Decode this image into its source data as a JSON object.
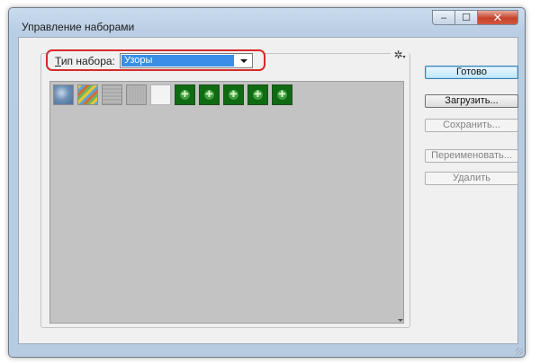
{
  "window": {
    "title": "Управление наборами",
    "controls": {
      "minimize": "‒",
      "maximize": "☐",
      "close": "✕"
    }
  },
  "preset_type": {
    "label_prefix": "Т",
    "label_rest": "ип набора:",
    "selected": "Узоры"
  },
  "settings_menu": {
    "icon": "gear-icon",
    "glyph": "✲",
    "arrow": "▾"
  },
  "swatches": [
    {
      "kind": "blue-texture",
      "style": "sw-blue"
    },
    {
      "kind": "rainbow-texture",
      "style": "sw-rainbow"
    },
    {
      "kind": "gray-texture",
      "style": "sw-gray1"
    },
    {
      "kind": "gray-texture",
      "style": "sw-gray2"
    },
    {
      "kind": "white-texture",
      "style": "sw-white"
    },
    {
      "kind": "green-pattern",
      "style": "sw-green",
      "glyph": "✚"
    },
    {
      "kind": "green-pattern",
      "style": "sw-green",
      "glyph": "✚"
    },
    {
      "kind": "green-pattern",
      "style": "sw-green",
      "glyph": "✚"
    },
    {
      "kind": "green-pattern",
      "style": "sw-green",
      "glyph": "✚"
    },
    {
      "kind": "green-pattern",
      "style": "sw-green",
      "glyph": "✚"
    }
  ],
  "buttons": {
    "done": "Готово",
    "load": "Загрузить...",
    "save": "Сохранить...",
    "rename": "Переименовать...",
    "delete": "Удалить"
  },
  "colors": {
    "highlight": "#d62a2a",
    "selection": "#3a8ee6",
    "swatch_green": "#0f6a12"
  }
}
